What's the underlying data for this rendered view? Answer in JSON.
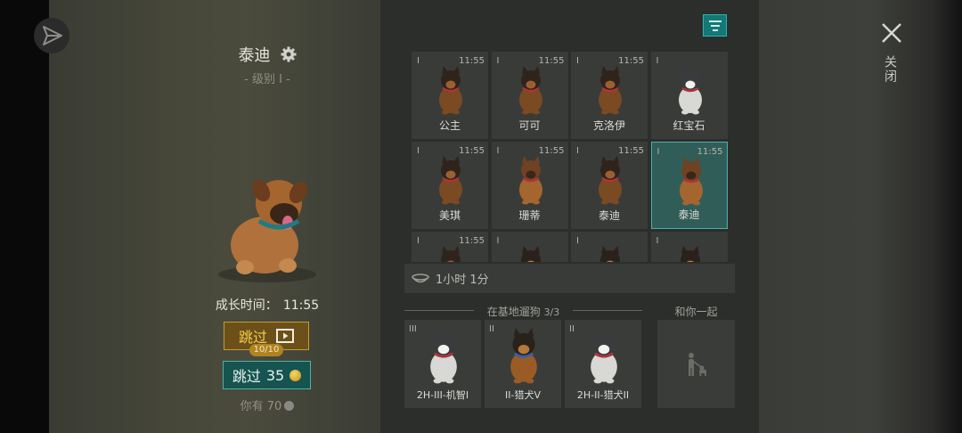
{
  "pet": {
    "name": "泰迪",
    "level": "- 级别 I -",
    "grow_label": "成长时间：",
    "grow_time": "11:55"
  },
  "actions": {
    "skip_ad_label": "跳过",
    "ad_count": "10/10",
    "skip_coin_label": "跳过",
    "skip_coin_cost": "35",
    "you_have": "你有 70"
  },
  "grid": {
    "cells": [
      {
        "level": "I",
        "time": "11:55",
        "name": "公主",
        "color": "black-tan"
      },
      {
        "level": "I",
        "time": "11:55",
        "name": "可可",
        "color": "black-tan"
      },
      {
        "level": "I",
        "time": "11:55",
        "name": "克洛伊",
        "color": "black-tan"
      },
      {
        "level": "I",
        "time": "",
        "name": "红宝石",
        "color": "husky"
      },
      {
        "level": "I",
        "time": "11:55",
        "name": "美琪",
        "color": "black-tan"
      },
      {
        "level": "I",
        "time": "11:55",
        "name": "珊蒂",
        "color": "brown"
      },
      {
        "level": "I",
        "time": "11:55",
        "name": "泰迪",
        "color": "black-tan"
      },
      {
        "level": "I",
        "time": "11:55",
        "name": "泰迪",
        "color": "brown",
        "selected": true
      },
      {
        "level": "I",
        "time": "11:55",
        "name": "",
        "color": "black-tan"
      },
      {
        "level": "I",
        "time": "",
        "name": "",
        "color": "shepherd"
      },
      {
        "level": "I",
        "time": "",
        "name": "",
        "color": "shepherd"
      },
      {
        "level": "I",
        "time": "",
        "name": "",
        "color": "shepherd"
      }
    ]
  },
  "timer": {
    "text": "1小时 1分"
  },
  "base": {
    "title": "在基地遛狗",
    "count": "3/3",
    "with_you": "和你一起",
    "dogs": [
      {
        "level": "III",
        "name": "2H-III-机智I",
        "color": "husky"
      },
      {
        "level": "II",
        "name": "II-猎犬V",
        "color": "shepherd"
      },
      {
        "level": "II",
        "name": "2H-II-猎犬II",
        "color": "husky"
      }
    ]
  },
  "close": {
    "label": "关闭"
  },
  "icons": {
    "share": "paper-plane-icon",
    "settings": "gear-icon",
    "filter": "filter-icon",
    "video": "video-play-icon",
    "coin": "gold-coin-icon",
    "bowl": "food-bowl-icon",
    "walk": "person-walking-dog-icon",
    "close": "close-icon"
  }
}
